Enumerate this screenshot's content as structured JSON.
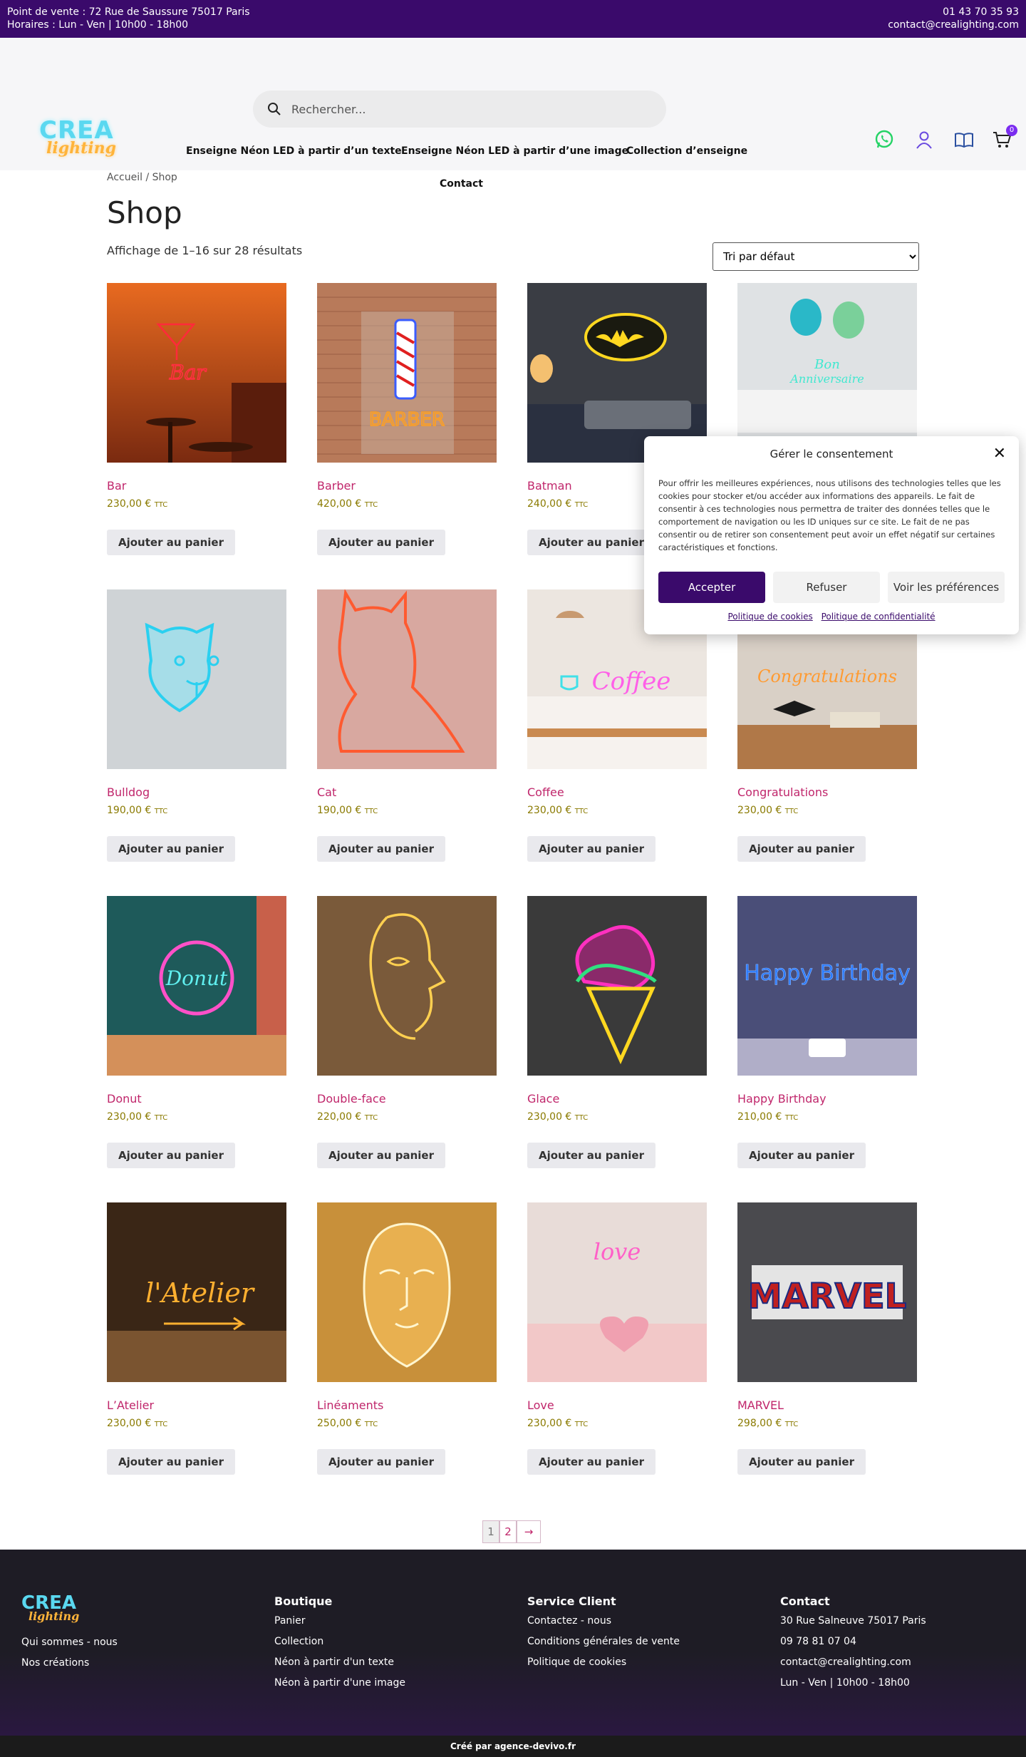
{
  "topbar": {
    "address": "Point de vente : 72 Rue de Saussure 75017 Paris",
    "hours": "Horaires : Lun - Ven | 10h00 - 18h00",
    "phone": "01 43 70 35 93",
    "email": "contact@crealighting.com"
  },
  "logo": {
    "line1": "CREA",
    "line2": "lighting"
  },
  "search": {
    "placeholder": "Rechercher..."
  },
  "nav": {
    "item1": "Enseigne Néon LED à partir d’un texte",
    "item2": "Enseigne Néon LED à partir d’une image",
    "item3": "Collection d’enseigne",
    "item4": "Contact"
  },
  "header_icons": {
    "whatsapp": "whatsapp-icon",
    "account": "user-icon",
    "catalog": "book-icon",
    "cart": "cart-icon",
    "cart_count": "0"
  },
  "breadcrumb": "Accueil / Shop",
  "page_title": "Shop",
  "results": "Affichage de 1–16 sur 28 résultats",
  "sort": {
    "selected": "Tri par défaut"
  },
  "products": [
    {
      "name": "Bar",
      "price": "230,00 €",
      "ttc": "TTC",
      "button": "Ajouter au panier"
    },
    {
      "name": "Barber",
      "price": "420,00 €",
      "ttc": "TTC",
      "button": "Ajouter au panier"
    },
    {
      "name": "Batman",
      "price": "240,00 €",
      "ttc": "TTC",
      "button": "Ajouter au panier"
    },
    {
      "name": "Bon Anniversaire",
      "price": "",
      "ttc": "",
      "button": ""
    },
    {
      "name": "Bulldog",
      "price": "190,00 €",
      "ttc": "TTC",
      "button": "Ajouter au panier"
    },
    {
      "name": "Cat",
      "price": "190,00 €",
      "ttc": "TTC",
      "button": "Ajouter au panier"
    },
    {
      "name": "Coffee",
      "price": "230,00 €",
      "ttc": "TTC",
      "button": "Ajouter au panier"
    },
    {
      "name": "Congratulations",
      "price": "230,00 €",
      "ttc": "TTC",
      "button": "Ajouter au panier"
    },
    {
      "name": "Donut",
      "price": "230,00 €",
      "ttc": "TTC",
      "button": "Ajouter au panier"
    },
    {
      "name": "Double-face",
      "price": "220,00 €",
      "ttc": "TTC",
      "button": "Ajouter au panier"
    },
    {
      "name": "Glace",
      "price": "230,00 €",
      "ttc": "TTC",
      "button": "Ajouter au panier"
    },
    {
      "name": "Happy Birthday",
      "price": "210,00 €",
      "ttc": "TTC",
      "button": "Ajouter au panier"
    },
    {
      "name": "L’Atelier",
      "price": "230,00 €",
      "ttc": "TTC",
      "button": "Ajouter au panier"
    },
    {
      "name": "Linéaments",
      "price": "250,00 €",
      "ttc": "TTC",
      "button": "Ajouter au panier"
    },
    {
      "name": "Love",
      "price": "230,00 €",
      "ttc": "TTC",
      "button": "Ajouter au panier"
    },
    {
      "name": "MARVEL",
      "price": "298,00 €",
      "ttc": "TTC",
      "button": "Ajouter au panier"
    }
  ],
  "thumb_text": {
    "bar": "Bar",
    "barber": "BARBER",
    "bon": "Bon",
    "anniv": "Anniversaire",
    "coffee": "Coffee",
    "congrats": "Congratulations",
    "donut": "Donut",
    "happy": "Happy Birthday",
    "atelier": "l'Atelier",
    "love": "love",
    "marvel": "MARVEL"
  },
  "pagination": {
    "p1": "1",
    "p2": "2",
    "next": "→"
  },
  "footer": {
    "about1": "Qui sommes - nous",
    "about2": "Nos créations",
    "boutique_title": "Boutique",
    "boutique": [
      "Panier",
      "Collection",
      "Néon à partir d'un texte",
      "Néon à partir d'une image"
    ],
    "service_title": "Service Client",
    "service": [
      "Contactez - nous",
      "Conditions générales de vente",
      "Politique de cookies"
    ],
    "contact_title": "Contact",
    "contact": [
      "30 Rue Salneuve 75017 Paris",
      "09 78 81 07 04",
      "contact@crealighting.com",
      "Lun - Ven | 10h00 - 18h00"
    ],
    "credit": "Créé par agence-devivo.fr"
  },
  "consent": {
    "title": "Gérer le consentement",
    "text": "Pour offrir les meilleures expériences, nous utilisons des technologies telles que les cookies pour stocker et/ou accéder aux informations des appareils. Le fait de consentir à ces technologies nous permettra de traiter des données telles que le comportement de navigation ou les ID uniques sur ce site. Le fait de ne pas consentir ou de retirer son consentement peut avoir un effet négatif sur certaines caractéristiques et fonctions.",
    "accept": "Accepter",
    "refuse": "Refuser",
    "prefs": "Voir les préférences",
    "link1": "Politique de cookies",
    "link2": "Politique de confidentialité"
  },
  "colors": {
    "brand": "#3a0a6b",
    "product_name": "#c0266b",
    "price": "#8a7a00",
    "footer_bg": "#1e1c25"
  }
}
